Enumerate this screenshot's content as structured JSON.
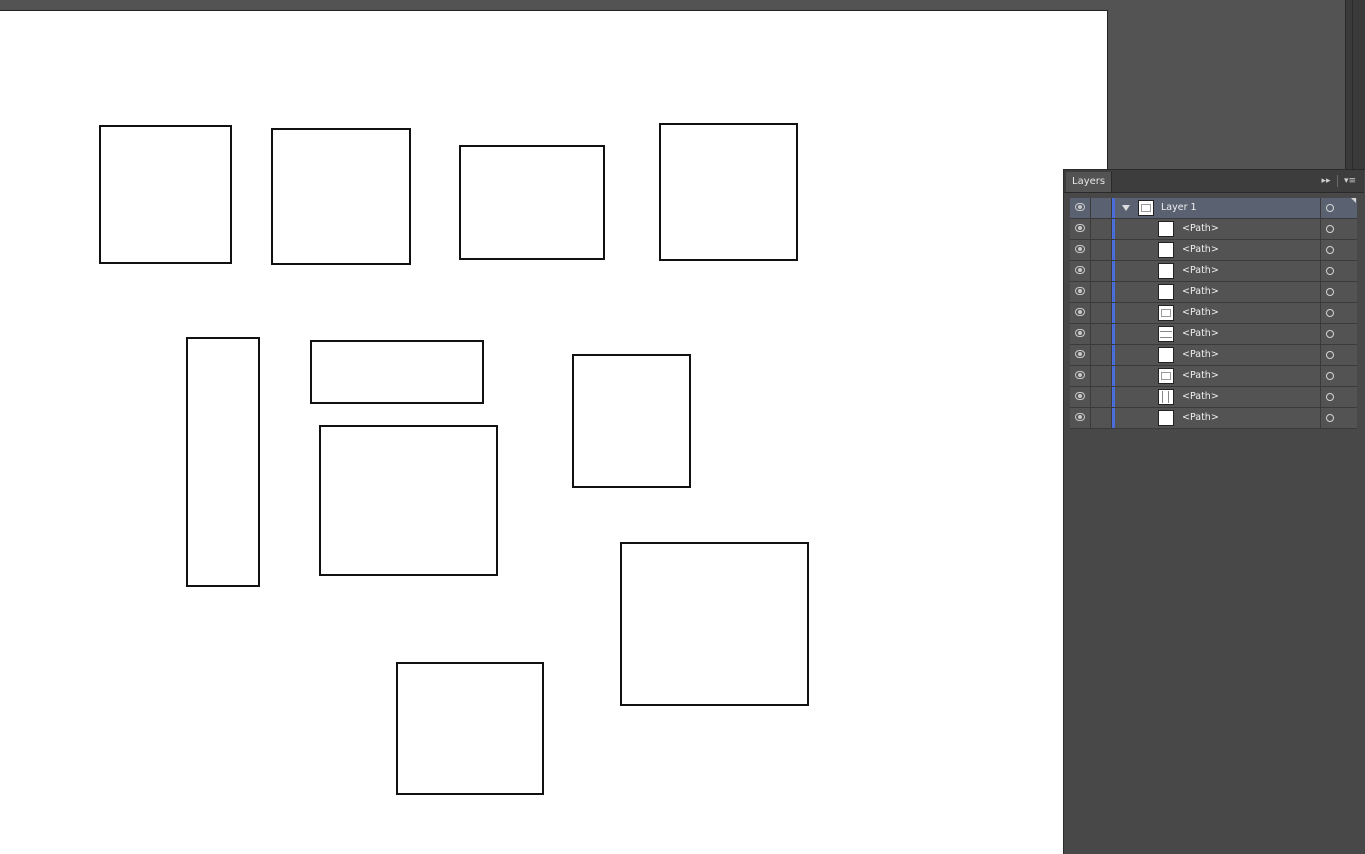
{
  "panel": {
    "tab_label": "Layers",
    "expand_glyph": "▸▸",
    "menu_glyph": "▾≡"
  },
  "layers": {
    "layer_name": "Layer 1",
    "paths": [
      {
        "label": "<Path>",
        "thumb": "plain"
      },
      {
        "label": "<Path>",
        "thumb": "plain"
      },
      {
        "label": "<Path>",
        "thumb": "plain"
      },
      {
        "label": "<Path>",
        "thumb": "plain"
      },
      {
        "label": "<Path>",
        "thumb": "grid"
      },
      {
        "label": "<Path>",
        "thumb": "hlines"
      },
      {
        "label": "<Path>",
        "thumb": "plain"
      },
      {
        "label": "<Path>",
        "thumb": "grid"
      },
      {
        "label": "<Path>",
        "thumb": "vlines"
      },
      {
        "label": "<Path>",
        "thumb": "plain"
      }
    ]
  },
  "colors": {
    "layer_color": "#4a6ddb",
    "canvas_bg": "#535353",
    "artboard": "#ffffff"
  },
  "icons": {
    "visibility": "eye-icon",
    "expand": "disclosure-triangle-icon",
    "target": "target-circle-icon"
  }
}
